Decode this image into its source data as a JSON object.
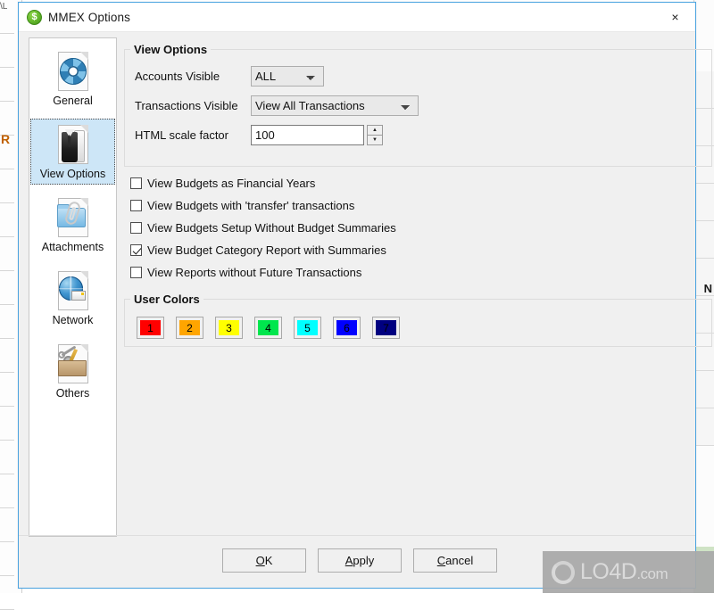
{
  "window": {
    "title": "MMEX Options",
    "app_icon": "dollar-coin-icon",
    "close_label": "×"
  },
  "sidebar": {
    "items": [
      {
        "label": "General",
        "icon": "gear-document-icon",
        "selected": false
      },
      {
        "label": "View Options",
        "icon": "suit-document-icon",
        "selected": true
      },
      {
        "label": "Attachments",
        "icon": "paperclip-folder-icon",
        "selected": false
      },
      {
        "label": "Network",
        "icon": "globe-document-icon",
        "selected": false
      },
      {
        "label": "Others",
        "icon": "toolbox-document-icon",
        "selected": false
      }
    ]
  },
  "view_options": {
    "group_title": "View Options",
    "accounts_visible": {
      "label": "Accounts Visible",
      "value": "ALL",
      "options": [
        "ALL"
      ]
    },
    "transactions_visible": {
      "label": "Transactions Visible",
      "value": "View All Transactions",
      "options": [
        "View All Transactions"
      ]
    },
    "html_scale_factor": {
      "label": "HTML scale factor",
      "value": "100",
      "spin_up": "▲",
      "spin_down": "▼"
    },
    "checkboxes": [
      {
        "label": "View Budgets as Financial Years",
        "checked": false
      },
      {
        "label": "View Budgets with 'transfer' transactions",
        "checked": false
      },
      {
        "label": "View Budgets Setup Without Budget Summaries",
        "checked": false
      },
      {
        "label": "View Budget Category Report with Summaries",
        "checked": true
      },
      {
        "label": "View Reports without Future Transactions",
        "checked": false
      }
    ]
  },
  "user_colors": {
    "group_title": "User Colors",
    "swatches": [
      {
        "number": "1",
        "color": "#FF0000",
        "text_color": "#000000"
      },
      {
        "number": "2",
        "color": "#FFA500",
        "text_color": "#000000"
      },
      {
        "number": "3",
        "color": "#FFFF00",
        "text_color": "#000000"
      },
      {
        "number": "4",
        "color": "#00E64D",
        "text_color": "#000000"
      },
      {
        "number": "5",
        "color": "#00FFFF",
        "text_color": "#000000"
      },
      {
        "number": "6",
        "color": "#0000FF",
        "text_color": "#000000"
      },
      {
        "number": "7",
        "color": "#000080",
        "text_color": "#000000"
      }
    ]
  },
  "buttons": {
    "ok": {
      "accel": "O",
      "rest": "K"
    },
    "apply": {
      "accel": "A",
      "rest": "pply"
    },
    "cancel": {
      "accel": "C",
      "rest": "ancel"
    }
  },
  "watermark": {
    "name": "LO4D",
    "suffix": ".com"
  },
  "background": {
    "left_fragment": "\\L",
    "left_letter": "R",
    "right_letter": "N"
  }
}
